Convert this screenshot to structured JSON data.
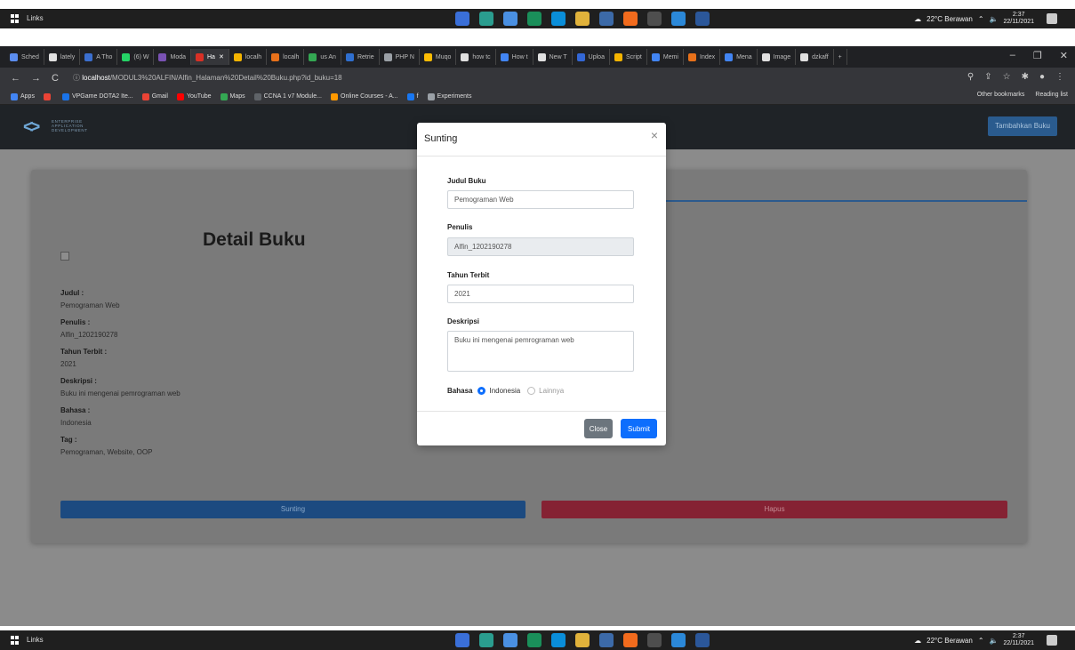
{
  "taskbar": {
    "links_label": "Links",
    "weather": "22°C Berawan",
    "time": "2:37",
    "date": "22/11/2021"
  },
  "browser": {
    "tabs": [
      {
        "label": "Sched",
        "color": "#5b8def"
      },
      {
        "label": "lately",
        "color": "#e0e0e0"
      },
      {
        "label": "A Tho",
        "color": "#3b6fcf"
      },
      {
        "label": "(6) W",
        "color": "#25d366"
      },
      {
        "label": "Moda",
        "color": "#7952b3"
      },
      {
        "label": "Ha",
        "color": "#d93025",
        "active": true
      },
      {
        "label": "localh",
        "color": "#f4b400"
      },
      {
        "label": "localh",
        "color": "#e8711a"
      },
      {
        "label": "us An",
        "color": "#34a853"
      },
      {
        "label": "Retrie",
        "color": "#2f6fcf"
      },
      {
        "label": "PHP N",
        "color": "#9aa0a6"
      },
      {
        "label": "Muqo",
        "color": "#fbbc04"
      },
      {
        "label": "how tc",
        "color": "#e0e0e0"
      },
      {
        "label": "How t",
        "color": "#4285f4"
      },
      {
        "label": "New T",
        "color": "#e0e0e0"
      },
      {
        "label": "Uploa",
        "color": "#3367d6"
      },
      {
        "label": "Script",
        "color": "#f4b400"
      },
      {
        "label": "Memi",
        "color": "#4285f4"
      },
      {
        "label": "Index",
        "color": "#e8711a"
      },
      {
        "label": "Mena",
        "color": "#4285f4"
      },
      {
        "label": "Image",
        "color": "#e0e0e0"
      },
      {
        "label": "dzkaff",
        "color": "#e0e0e0"
      }
    ],
    "url_host": "localhost",
    "url_path": "/MODUL3%20ALFIN/Alfin_Halaman%20Detail%20Buku.php?id_buku=18",
    "bookmarks": [
      {
        "label": "Apps",
        "color": "#4285f4"
      },
      {
        "label": "",
        "color": "#ea4335"
      },
      {
        "label": "VPGame DOTA2 Ite...",
        "color": "#1a73e8"
      },
      {
        "label": "Gmail",
        "color": "#ea4335"
      },
      {
        "label": "YouTube",
        "color": "#ff0000"
      },
      {
        "label": "Maps",
        "color": "#34a853"
      },
      {
        "label": "CCNA 1 v7 Module...",
        "color": "#5f6368"
      },
      {
        "label": "Online Courses - A...",
        "color": "#ff9900"
      },
      {
        "label": "f",
        "color": "#1877f2"
      },
      {
        "label": "Experiments",
        "color": "#9aa0a6"
      }
    ],
    "other_bookmarks": "Other bookmarks",
    "reading_list": "Reading list"
  },
  "navbar": {
    "brand_line1": "ENTERPRISE",
    "brand_line2": "APPLICATION",
    "brand_line3": "DEVELOPMENT",
    "add_button": "Tambahkan Buku"
  },
  "detail": {
    "title": "Detail Buku",
    "fields": [
      {
        "label": "Judul :",
        "value": "Pemograman Web"
      },
      {
        "label": "Penulis :",
        "value": "Alfin_1202190278"
      },
      {
        "label": "Tahun Terbit :",
        "value": "2021"
      },
      {
        "label": "Deskripsi :",
        "value": "Buku ini mengenai pemrograman web"
      },
      {
        "label": "Bahasa :",
        "value": "Indonesia"
      },
      {
        "label": "Tag :",
        "value": "Pemograman, Website, OOP"
      }
    ],
    "edit_button": "Sunting",
    "delete_button": "Hapus"
  },
  "modal": {
    "title": "Sunting",
    "close_glyph": "×",
    "judul_label": "Judul Buku",
    "judul_value": "Pemograman Web",
    "penulis_label": "Penulis",
    "penulis_value": "Alfin_1202190278",
    "tahun_label": "Tahun Terbit",
    "tahun_value": "2021",
    "deskripsi_label": "Deskripsi",
    "deskripsi_value": "Buku ini mengenai pemrograman web",
    "bahasa_label": "Bahasa",
    "bahasa_options": [
      "Indonesia",
      "Lainnya"
    ],
    "bahasa_selected": "Indonesia",
    "close_button": "Close",
    "submit_button": "Submit"
  }
}
